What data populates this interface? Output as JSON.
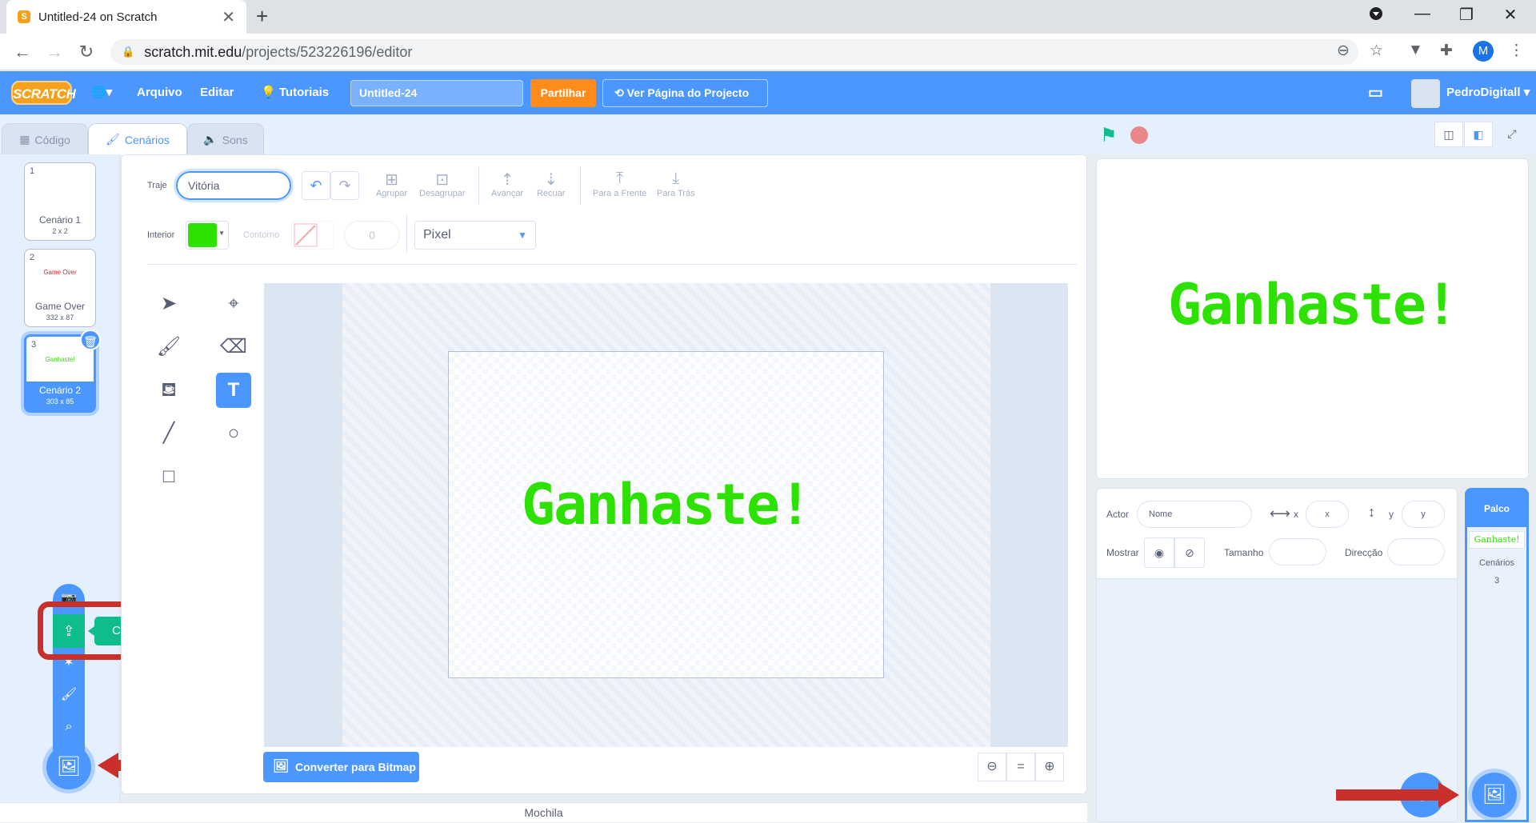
{
  "browser": {
    "tab_title": "Untitled-24 on Scratch",
    "tab_close": "✕",
    "new_tab": "+",
    "url_host": "scratch.mit.edu",
    "url_path": "/projects/523226196/editor",
    "profile_initial": "M"
  },
  "menubar": {
    "logo": "SCRATCH",
    "file": "Arquivo",
    "edit": "Editar",
    "tutorials": "Tutoriais",
    "project_title": "Untitled-24",
    "share": "Partilhar",
    "project_page": "Ver Página do Projecto",
    "username": "PedroDigitall"
  },
  "tabs": {
    "code": "Código",
    "costumes": "Cenários",
    "sounds": "Sons"
  },
  "costumes": [
    {
      "num": "1",
      "name": "Cenário 1",
      "size": "2 x 2",
      "thumb": ""
    },
    {
      "num": "2",
      "name": "Game Over",
      "size": "332 x 87",
      "thumb": "Game Over"
    },
    {
      "num": "3",
      "name": "Cenário 2",
      "size": "303 x 85",
      "thumb": "Ganhaste!"
    }
  ],
  "add_menu": {
    "tooltip": "Carregar Cenário"
  },
  "paint": {
    "costume_label": "Traje",
    "costume_name": "Vitória",
    "group": "Agrupar",
    "ungroup": "Desagrupar",
    "forward": "Avançar",
    "backward": "Recuar",
    "front": "Para a Frente",
    "back": "Para Trás",
    "fill_label": "Interior",
    "outline_label": "Contorno",
    "outline_width": "0",
    "font": "Pixel",
    "canvas_text": "Ganhaste!",
    "convert_bitmap": "Converter para Bitmap",
    "zoom_reset": "="
  },
  "backpack": "Mochila",
  "stage": {
    "text": "Ganhaste!"
  },
  "sprite_info": {
    "sprite_label": "Actor",
    "name_placeholder": "Nome",
    "x_label": "x",
    "x_placeholder": "x",
    "y_label": "y",
    "y_placeholder": "y",
    "show_label": "Mostrar",
    "size_label": "Tamanho",
    "direction_label": "Direcção"
  },
  "stage_pane": {
    "title": "Palco",
    "thumb_text": "Ganhaste!",
    "backdrops_label": "Cenários",
    "backdrops_count": "3"
  },
  "colors": {
    "scratch_blue": "#4c97ff",
    "fill_color": "#2de100",
    "share_orange": "#ff8c1a",
    "upload_green": "#0fbd8c",
    "annotation_red": "#c9302c"
  }
}
